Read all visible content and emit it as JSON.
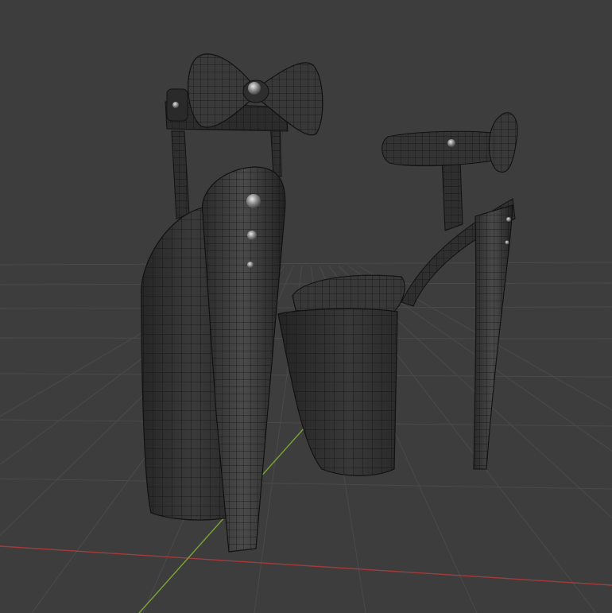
{
  "viewport": {
    "background_color": "#3d3d3d",
    "floor_grid_color": "#4a4a4a",
    "x_axis_color": "#a33b3b",
    "y_axis_color": "#7aa534",
    "wire_color": "#121212",
    "mesh_fill_color": "#303030",
    "mesh_highlight_color": "#4b4b4b",
    "stud_color": "#9a9a9a"
  },
  "scene": {
    "objects": [
      {
        "name": "platform-sandal-back-view"
      },
      {
        "name": "platform-sandal-side-view"
      }
    ],
    "floor_grid": true,
    "shading": "solid-wireframe"
  }
}
